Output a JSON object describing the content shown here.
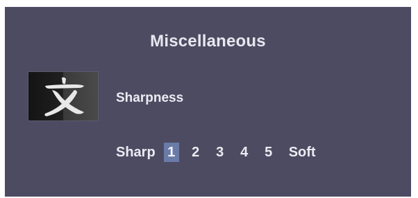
{
  "menu": {
    "title": "Miscellaneous",
    "icon": "text-character-icon"
  },
  "setting": {
    "label": "Sharpness",
    "scale_start": "Sharp",
    "scale_end": "Soft",
    "options": [
      "1",
      "2",
      "3",
      "4",
      "5"
    ],
    "selected": "1"
  },
  "colors": {
    "background": "#4c4b62",
    "selected_highlight": "#6b7ba8",
    "text": "#ebebf2"
  }
}
